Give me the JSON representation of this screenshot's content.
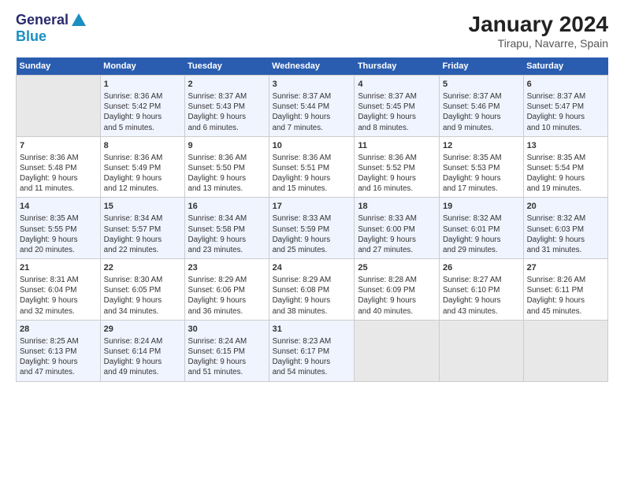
{
  "logo": {
    "line1": "General",
    "line2": "Blue"
  },
  "title": "January 2024",
  "subtitle": "Tirapu, Navarre, Spain",
  "headers": [
    "Sunday",
    "Monday",
    "Tuesday",
    "Wednesday",
    "Thursday",
    "Friday",
    "Saturday"
  ],
  "weeks": [
    [
      {
        "day": "",
        "info": ""
      },
      {
        "day": "1",
        "info": "Sunrise: 8:36 AM\nSunset: 5:42 PM\nDaylight: 9 hours\nand 5 minutes."
      },
      {
        "day": "2",
        "info": "Sunrise: 8:37 AM\nSunset: 5:43 PM\nDaylight: 9 hours\nand 6 minutes."
      },
      {
        "day": "3",
        "info": "Sunrise: 8:37 AM\nSunset: 5:44 PM\nDaylight: 9 hours\nand 7 minutes."
      },
      {
        "day": "4",
        "info": "Sunrise: 8:37 AM\nSunset: 5:45 PM\nDaylight: 9 hours\nand 8 minutes."
      },
      {
        "day": "5",
        "info": "Sunrise: 8:37 AM\nSunset: 5:46 PM\nDaylight: 9 hours\nand 9 minutes."
      },
      {
        "day": "6",
        "info": "Sunrise: 8:37 AM\nSunset: 5:47 PM\nDaylight: 9 hours\nand 10 minutes."
      }
    ],
    [
      {
        "day": "7",
        "info": "Sunrise: 8:36 AM\nSunset: 5:48 PM\nDaylight: 9 hours\nand 11 minutes."
      },
      {
        "day": "8",
        "info": "Sunrise: 8:36 AM\nSunset: 5:49 PM\nDaylight: 9 hours\nand 12 minutes."
      },
      {
        "day": "9",
        "info": "Sunrise: 8:36 AM\nSunset: 5:50 PM\nDaylight: 9 hours\nand 13 minutes."
      },
      {
        "day": "10",
        "info": "Sunrise: 8:36 AM\nSunset: 5:51 PM\nDaylight: 9 hours\nand 15 minutes."
      },
      {
        "day": "11",
        "info": "Sunrise: 8:36 AM\nSunset: 5:52 PM\nDaylight: 9 hours\nand 16 minutes."
      },
      {
        "day": "12",
        "info": "Sunrise: 8:35 AM\nSunset: 5:53 PM\nDaylight: 9 hours\nand 17 minutes."
      },
      {
        "day": "13",
        "info": "Sunrise: 8:35 AM\nSunset: 5:54 PM\nDaylight: 9 hours\nand 19 minutes."
      }
    ],
    [
      {
        "day": "14",
        "info": "Sunrise: 8:35 AM\nSunset: 5:55 PM\nDaylight: 9 hours\nand 20 minutes."
      },
      {
        "day": "15",
        "info": "Sunrise: 8:34 AM\nSunset: 5:57 PM\nDaylight: 9 hours\nand 22 minutes."
      },
      {
        "day": "16",
        "info": "Sunrise: 8:34 AM\nSunset: 5:58 PM\nDaylight: 9 hours\nand 23 minutes."
      },
      {
        "day": "17",
        "info": "Sunrise: 8:33 AM\nSunset: 5:59 PM\nDaylight: 9 hours\nand 25 minutes."
      },
      {
        "day": "18",
        "info": "Sunrise: 8:33 AM\nSunset: 6:00 PM\nDaylight: 9 hours\nand 27 minutes."
      },
      {
        "day": "19",
        "info": "Sunrise: 8:32 AM\nSunset: 6:01 PM\nDaylight: 9 hours\nand 29 minutes."
      },
      {
        "day": "20",
        "info": "Sunrise: 8:32 AM\nSunset: 6:03 PM\nDaylight: 9 hours\nand 31 minutes."
      }
    ],
    [
      {
        "day": "21",
        "info": "Sunrise: 8:31 AM\nSunset: 6:04 PM\nDaylight: 9 hours\nand 32 minutes."
      },
      {
        "day": "22",
        "info": "Sunrise: 8:30 AM\nSunset: 6:05 PM\nDaylight: 9 hours\nand 34 minutes."
      },
      {
        "day": "23",
        "info": "Sunrise: 8:29 AM\nSunset: 6:06 PM\nDaylight: 9 hours\nand 36 minutes."
      },
      {
        "day": "24",
        "info": "Sunrise: 8:29 AM\nSunset: 6:08 PM\nDaylight: 9 hours\nand 38 minutes."
      },
      {
        "day": "25",
        "info": "Sunrise: 8:28 AM\nSunset: 6:09 PM\nDaylight: 9 hours\nand 40 minutes."
      },
      {
        "day": "26",
        "info": "Sunrise: 8:27 AM\nSunset: 6:10 PM\nDaylight: 9 hours\nand 43 minutes."
      },
      {
        "day": "27",
        "info": "Sunrise: 8:26 AM\nSunset: 6:11 PM\nDaylight: 9 hours\nand 45 minutes."
      }
    ],
    [
      {
        "day": "28",
        "info": "Sunrise: 8:25 AM\nSunset: 6:13 PM\nDaylight: 9 hours\nand 47 minutes."
      },
      {
        "day": "29",
        "info": "Sunrise: 8:24 AM\nSunset: 6:14 PM\nDaylight: 9 hours\nand 49 minutes."
      },
      {
        "day": "30",
        "info": "Sunrise: 8:24 AM\nSunset: 6:15 PM\nDaylight: 9 hours\nand 51 minutes."
      },
      {
        "day": "31",
        "info": "Sunrise: 8:23 AM\nSunset: 6:17 PM\nDaylight: 9 hours\nand 54 minutes."
      },
      {
        "day": "",
        "info": ""
      },
      {
        "day": "",
        "info": ""
      },
      {
        "day": "",
        "info": ""
      }
    ]
  ]
}
